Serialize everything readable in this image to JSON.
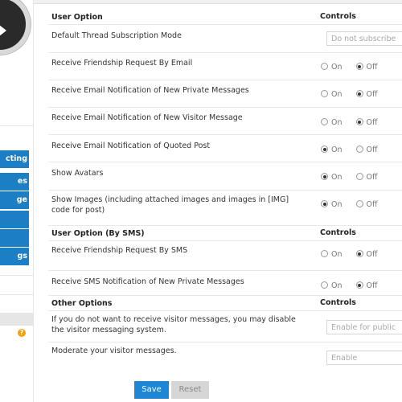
{
  "sidebar": {
    "tabs": [
      {
        "label": "cting"
      },
      {
        "label": "es"
      },
      {
        "label": "ge"
      },
      {
        "label": ""
      },
      {
        "label": ""
      },
      {
        "label": "gs"
      }
    ],
    "help_glyph": "?",
    "accent_color": "#1c7ec4"
  },
  "sections": {
    "user_option": {
      "title": "User Option",
      "controls_title": "Controls"
    },
    "sms": {
      "title": "User Option (By SMS)",
      "controls_title": "Controls"
    },
    "other": {
      "title": "Other Options",
      "controls_title": "Controls"
    }
  },
  "radio_labels": {
    "on": "On",
    "off": "Off"
  },
  "rows": {
    "thread_subscription": {
      "label": "Default Thread Subscription Mode",
      "value": "Do not subscribe"
    },
    "friendship_email": {
      "label": "Receive Friendship Request By Email",
      "selected": "off"
    },
    "private_messages": {
      "label": "Receive Email Notification of New Private Messages",
      "selected": "off"
    },
    "visitor_message": {
      "label": "Receive Email Notification of New Visitor Message",
      "selected": "off"
    },
    "quoted_post": {
      "label": "Receive Email Notification of Quoted Post",
      "selected": "on"
    },
    "show_avatars": {
      "label": "Show Avatars",
      "selected": "on"
    },
    "show_images": {
      "label": "Show Images (including attached images and images in [IMG] code for post)",
      "selected": "on"
    },
    "friendship_sms": {
      "label": "Receive Friendship Request By SMS",
      "selected": "off"
    },
    "sms_private_messages": {
      "label": "Receive SMS Notification of New Private Messages",
      "selected": "off"
    },
    "visitor_messaging": {
      "label": "If you do not want to receive visitor messages, you may disable the visitor messaging system.",
      "value": "Enable for public"
    },
    "moderate_visitor": {
      "label": "Moderate your visitor messages.",
      "value": "Enable"
    }
  },
  "buttons": {
    "save": "Save",
    "reset": "Reset"
  },
  "colors": {
    "save_button": "#1f86d6",
    "reset_button": "#d6d6d6"
  }
}
